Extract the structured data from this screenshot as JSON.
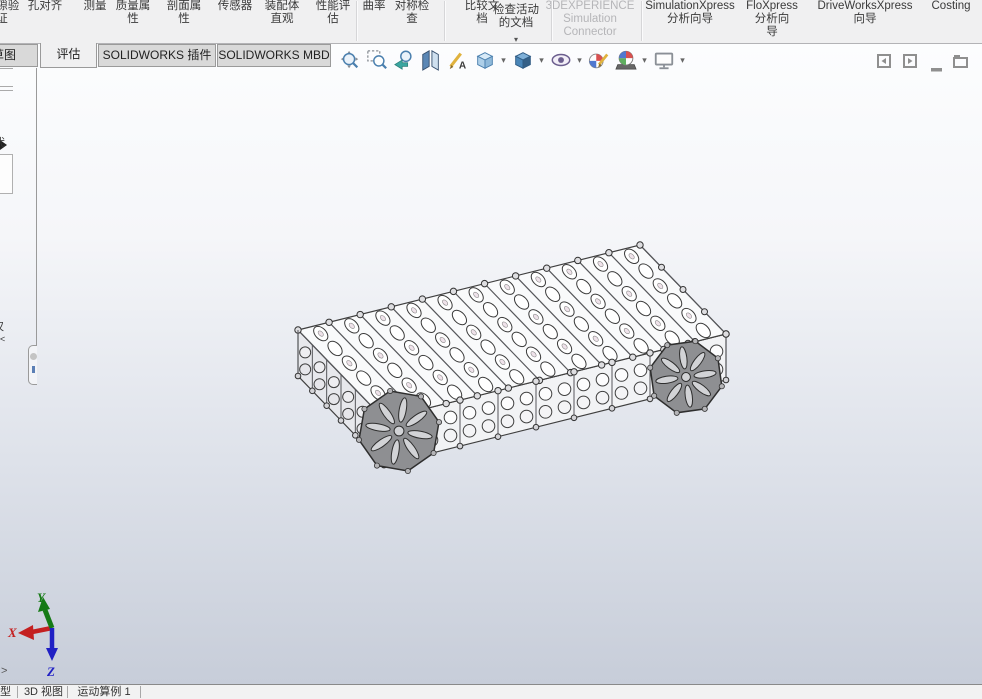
{
  "ribbon": {
    "items": [
      {
        "label": "间隙验\n证",
        "enabled": true
      },
      {
        "label": "孔对齐",
        "enabled": true
      },
      {
        "label": "测量",
        "enabled": true
      },
      {
        "label": "质量属\n性",
        "enabled": true
      },
      {
        "label": "剖面属\n性",
        "enabled": true
      },
      {
        "label": "传感器",
        "enabled": true
      },
      {
        "label": "装配体\n直观",
        "enabled": true
      },
      {
        "label": "性能评\n估",
        "enabled": true
      },
      {
        "label": "曲率",
        "enabled": true
      },
      {
        "label": "对称检\n查",
        "enabled": true
      },
      {
        "label": "比较文\n档",
        "enabled": true
      },
      {
        "label": "检查活动\n的文档",
        "enabled": true,
        "dropdown": "▾"
      },
      {
        "label": "3DEXPERIENCE\nSimulation\nConnector",
        "enabled": false
      },
      {
        "label": "SimulationXpress\n分析向导",
        "enabled": true
      },
      {
        "label": "FloXpress\n分析向\n导",
        "enabled": true
      },
      {
        "label": "DriveWorksXpress\n向导",
        "enabled": true
      },
      {
        "label": "Costing",
        "enabled": true
      }
    ]
  },
  "tabs": {
    "items": [
      {
        "label": "草图",
        "active": false
      },
      {
        "label": "评估",
        "active": true
      },
      {
        "label": "SOLIDWORKS 插件",
        "active": false
      },
      {
        "label": "SOLIDWORKS MBD",
        "active": false
      }
    ]
  },
  "headsup": {
    "icons": [
      "zoom-to-fit",
      "zoom-to-area",
      "previous-view",
      "section-view",
      "annotation-view",
      "view-orientation",
      "display-style",
      "hide-show-items",
      "edit-appearance",
      "apply-scene",
      "view-settings"
    ]
  },
  "window_controls": [
    "collapse-left-pane",
    "collapse-right-pane",
    "minimize",
    "restore"
  ],
  "viewport": {
    "background_top": "#fcfdfe",
    "background_bottom": "#c7cdd9",
    "triad": {
      "x": "X",
      "y": "Y",
      "z": "Z",
      "x_color": "#c42020",
      "y_color": "#157a15",
      "z_color": "#2020c4"
    }
  },
  "left_panel": {
    "fragments": [
      "代",
      "仅",
      "<"
    ]
  },
  "bottom_bar": {
    "expand_arrow": ">",
    "tabs": [
      {
        "label": "模型"
      },
      {
        "label": "3D 视图"
      },
      {
        "label": "运动算例 1"
      }
    ]
  }
}
